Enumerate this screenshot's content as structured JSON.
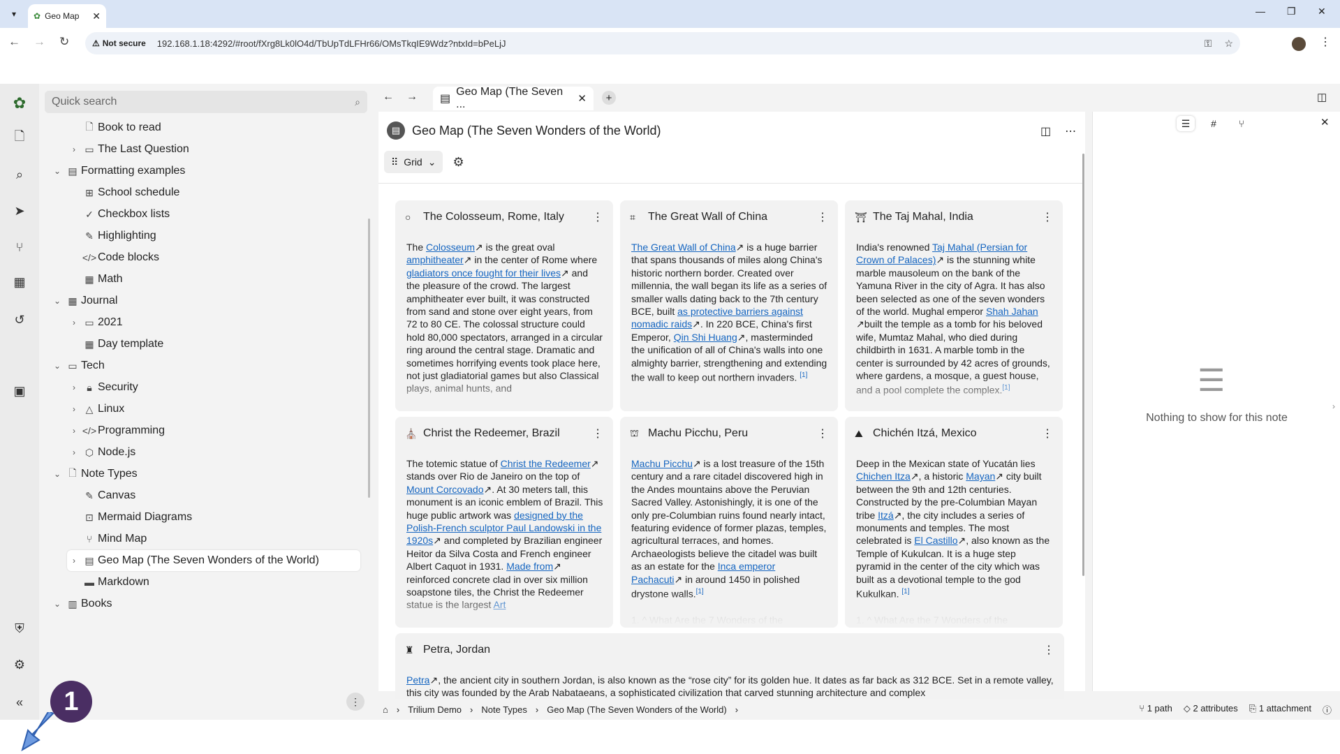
{
  "browser": {
    "tab_title": "Geo Map",
    "not_secure": "Not secure",
    "url": "192.168.1.18:4292/#root/fXrg8Lk0lO4d/TbUpTdLFHr66/OMsTkqIE9Wdz?ntxId=bPeLjJ"
  },
  "search": {
    "placeholder": "Quick search"
  },
  "tree": [
    {
      "label": "Book to read"
    },
    {
      "label": "The Last Question"
    },
    {
      "label": "Formatting examples"
    },
    {
      "label": "School schedule"
    },
    {
      "label": "Checkbox lists"
    },
    {
      "label": "Highlighting"
    },
    {
      "label": "Code blocks"
    },
    {
      "label": "Math"
    },
    {
      "label": "Journal"
    },
    {
      "label": "2021"
    },
    {
      "label": "Day template"
    },
    {
      "label": "Tech"
    },
    {
      "label": "Security"
    },
    {
      "label": "Linux"
    },
    {
      "label": "Programming"
    },
    {
      "label": "Node.js"
    },
    {
      "label": "Note Types"
    },
    {
      "label": "Canvas"
    },
    {
      "label": "Mermaid Diagrams"
    },
    {
      "label": "Mind Map"
    },
    {
      "label": "Geo Map (The Seven Wonders of the World)"
    },
    {
      "label": "Markdown"
    },
    {
      "label": "Books"
    }
  ],
  "tab": {
    "title": "Geo Map (The Seven ..."
  },
  "note": {
    "title": "Geo Map (The Seven Wonders of the World)",
    "view_label": "Grid"
  },
  "cards": [
    {
      "title": "The Colosseum, Rome, Italy"
    },
    {
      "title": "The Great Wall of China"
    },
    {
      "title": "The Taj Mahal, India"
    },
    {
      "title": "Christ the Redeemer, Brazil"
    },
    {
      "title": "Machu Picchu, Peru"
    },
    {
      "title": "Chichén Itzá, Mexico"
    },
    {
      "title": "Petra, Jordan"
    }
  ],
  "right_panel": {
    "empty": "Nothing to show for this note"
  },
  "status": {
    "crumbs": [
      "Trilium Demo",
      "Note Types",
      "Geo Map (The Seven Wonders of the World)"
    ],
    "path": "1 path",
    "attributes": "2 attributes",
    "attachment": "1 attachment"
  },
  "annotation": {
    "number": "1"
  }
}
